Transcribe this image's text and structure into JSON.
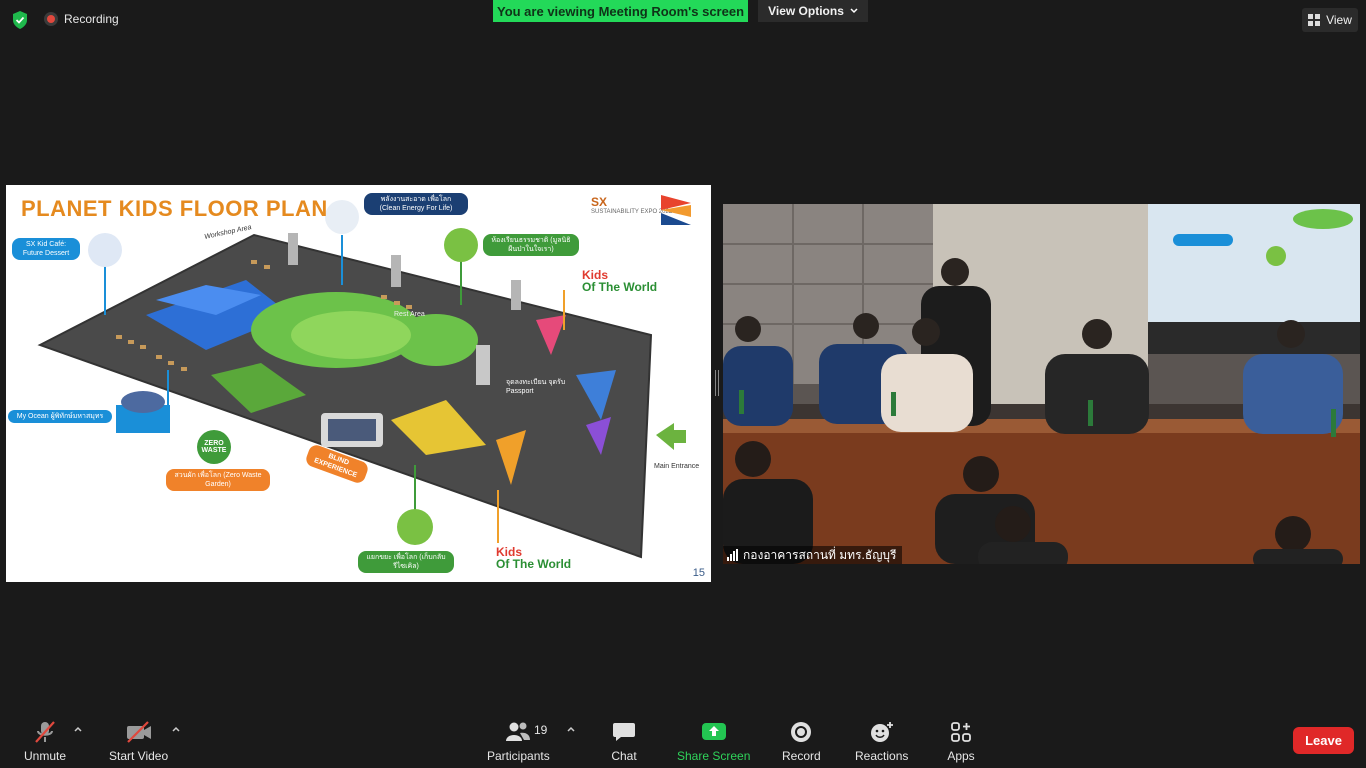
{
  "topbar": {
    "recording_label": "Recording",
    "viewing_banner": "You are viewing Meeting Room's screen",
    "view_options_label": "View Options",
    "view_label": "View"
  },
  "slide": {
    "title": "PLANET KIDS FLOOR PLAN",
    "logo_text": "SX",
    "logo_small": "SUSTAINABILITY EXPO 2022",
    "page_number": "15",
    "labels": {
      "kid_cafe": "SX Kid Café: Future Dessert",
      "workshop": "Workshop Area",
      "clean_energy": "พลังงานสะอาด เพื่อโลก (Clean Energy For Life)",
      "nature_class": "ห้องเรียนธรรมชาติ (มูลนิธิผืนป่าในใจเรา)",
      "kids_world_top_1": "Kids",
      "kids_world_top_2": "Of The World",
      "rest_area": "Rest Area",
      "passport": "จุดลงทะเบียน จุดรับ Passport",
      "my_ocean": "My Ocean ผู้พิทักษ์มหาสมุทร",
      "zero_waste_badge": "ZERO WASTE",
      "zero_waste_garden": "สวนผัก เพื่อโลก (Zero Waste Garden)",
      "blind": "BLIND EXPERIENCE",
      "main_entrance": "Main Entrance",
      "recycle": "แยกขยะ เพื่อโลก (เก็บกลับรีไซเคิล)",
      "kids_world_bottom_1": "Kids",
      "kids_world_bottom_2": "Of The World"
    }
  },
  "video": {
    "participant_name": "กองอาคารสถานที่ มทร.ธัญบุรี"
  },
  "toolbar": {
    "unmute": "Unmute",
    "start_video": "Start Video",
    "participants": "Participants",
    "participants_count": "19",
    "chat": "Chat",
    "share_screen": "Share Screen",
    "record": "Record",
    "reactions": "Reactions",
    "apps": "Apps",
    "leave": "Leave"
  },
  "colors": {
    "accent_green": "#23d959",
    "leave_red": "#e02828",
    "background": "#1a1a1a"
  }
}
